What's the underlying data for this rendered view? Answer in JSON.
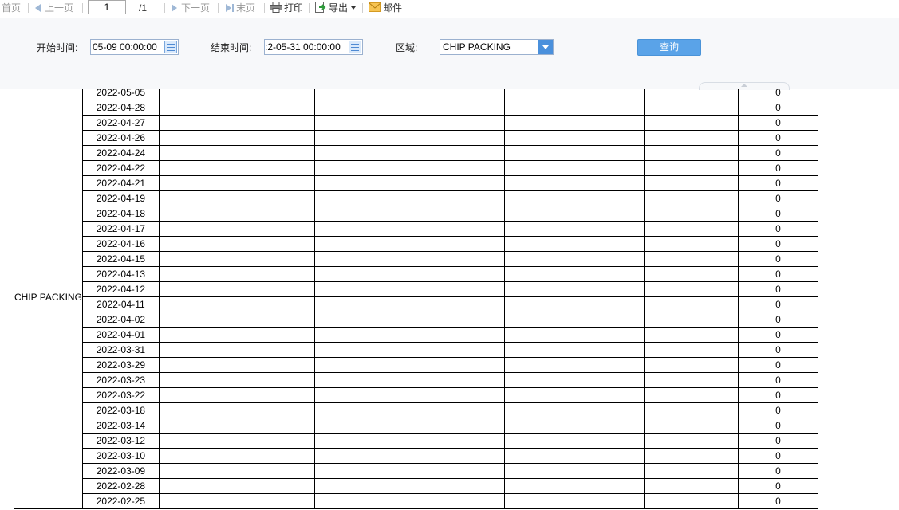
{
  "toolbar": {
    "first": "首页",
    "prev": "上一页",
    "page_value": "1",
    "page_total": "/1",
    "next": "下一页",
    "last": "末页",
    "print": "打印",
    "export": "导出",
    "mail": "邮件"
  },
  "filter": {
    "start_label": "开始时间:",
    "start_value": "05-09 00:00:00",
    "end_label": "结束时间:",
    "end_value": ":2-05-31 00:00:00",
    "area_label": "区域:",
    "area_value": "CHIP PACKING",
    "query_label": "查询"
  },
  "table": {
    "area": "CHIP PACKING",
    "rows": [
      {
        "date": "2022-05-05",
        "value": "0"
      },
      {
        "date": "2022-04-28",
        "value": "0"
      },
      {
        "date": "2022-04-27",
        "value": "0"
      },
      {
        "date": "2022-04-26",
        "value": "0"
      },
      {
        "date": "2022-04-24",
        "value": "0"
      },
      {
        "date": "2022-04-22",
        "value": "0"
      },
      {
        "date": "2022-04-21",
        "value": "0"
      },
      {
        "date": "2022-04-19",
        "value": "0"
      },
      {
        "date": "2022-04-18",
        "value": "0"
      },
      {
        "date": "2022-04-17",
        "value": "0"
      },
      {
        "date": "2022-04-16",
        "value": "0"
      },
      {
        "date": "2022-04-15",
        "value": "0"
      },
      {
        "date": "2022-04-13",
        "value": "0"
      },
      {
        "date": "2022-04-12",
        "value": "0"
      },
      {
        "date": "2022-04-11",
        "value": "0"
      },
      {
        "date": "2022-04-02",
        "value": "0"
      },
      {
        "date": "2022-04-01",
        "value": "0"
      },
      {
        "date": "2022-03-31",
        "value": "0"
      },
      {
        "date": "2022-03-29",
        "value": "0"
      },
      {
        "date": "2022-03-23",
        "value": "0"
      },
      {
        "date": "2022-03-22",
        "value": "0"
      },
      {
        "date": "2022-03-18",
        "value": "0"
      },
      {
        "date": "2022-03-14",
        "value": "0"
      },
      {
        "date": "2022-03-12",
        "value": "0"
      },
      {
        "date": "2022-03-10",
        "value": "0"
      },
      {
        "date": "2022-03-09",
        "value": "0"
      },
      {
        "date": "2022-02-28",
        "value": "0"
      },
      {
        "date": "2022-02-25",
        "value": "0"
      }
    ]
  }
}
